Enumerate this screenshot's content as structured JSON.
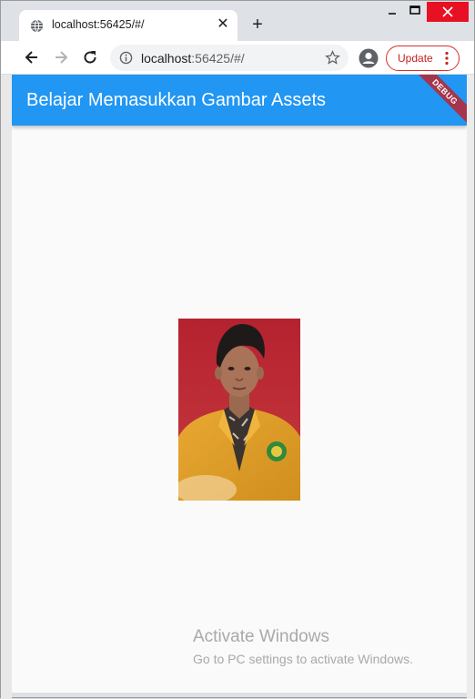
{
  "tab": {
    "title": "localhost:56425/#/",
    "favicon": "globe-icon"
  },
  "toolbar": {
    "url_host": "localhost",
    "url_rest": ":56425/#/",
    "update_label": "Update"
  },
  "app": {
    "title": "Belajar Memasukkan Gambar Assets",
    "debug_label": "DEBUG",
    "appbar_color": "#2196f3",
    "banner_color": "#a5354c",
    "image_alt": "portrait photo"
  },
  "watermark": {
    "title": "Activate Windows",
    "subtitle": "Go to PC settings to activate Windows."
  }
}
